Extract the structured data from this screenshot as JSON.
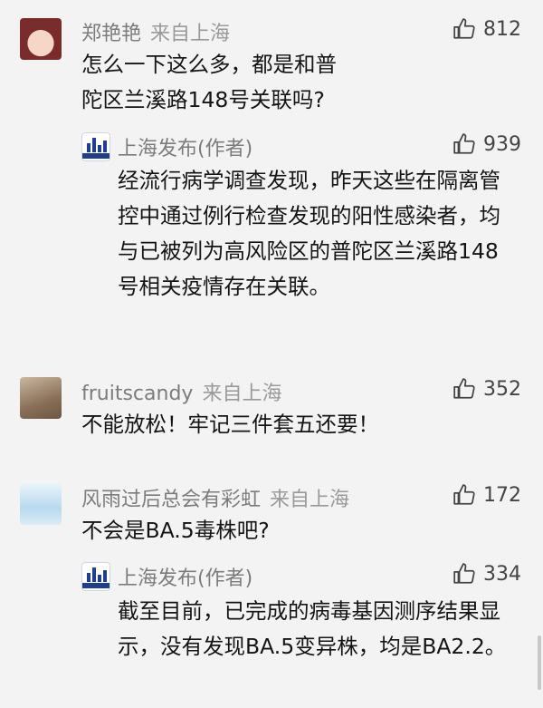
{
  "comments": [
    {
      "user": "郑艳艳",
      "location": "来自上海",
      "likes": "812",
      "text": "怎么一下这么多，都是和普陀区兰溪路148号关联吗?",
      "reply": {
        "user": "上海发布(作者)",
        "likes": "939",
        "text": "经流行病学调查发现，昨天这些在隔离管控中通过例行检查发现的阳性感染者，均与已被列为高风险区的普陀区兰溪路148号相关疫情存在关联。"
      }
    },
    {
      "user": "fruitscandy",
      "location": "来自上海",
      "likes": "352",
      "text": "不能放松！牢记三件套五还要！"
    },
    {
      "user": "风雨过后总会有彩虹",
      "location": "来自上海",
      "likes": "172",
      "text": "不会是BA.5毒株吧?",
      "reply": {
        "user": "上海发布(作者)",
        "likes": "334",
        "text": "截至目前，已完成的病毒基因测序结果显示，没有发现BA.5变异株，均是BA2.2。"
      }
    }
  ],
  "icons": {
    "like": "thumbs-up-icon"
  },
  "colors": {
    "background": "#f3f3f3",
    "name": "#7c7c7c",
    "text": "#141414",
    "official": "#1f3e8f"
  }
}
